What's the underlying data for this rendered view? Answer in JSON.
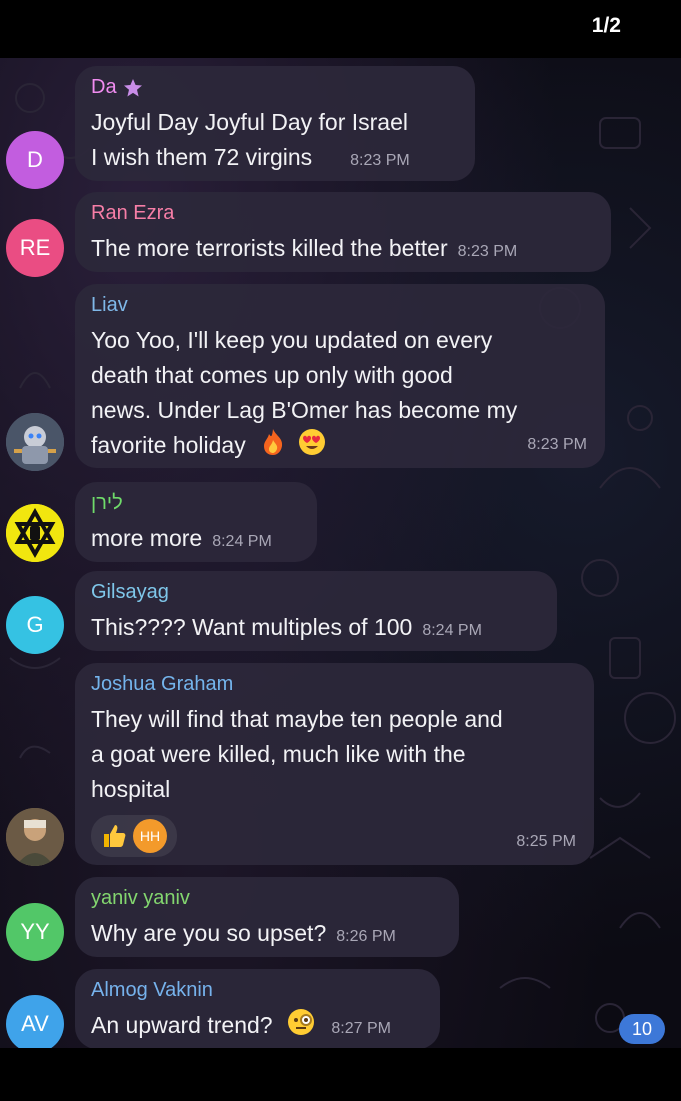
{
  "header": {
    "page_counter": "1/2"
  },
  "messages": [
    {
      "sender": "Da",
      "sender_color": "#f08cf0",
      "avatar_text": "D",
      "avatar_color": "#c25ddf",
      "lines": [
        "Joyful Day Joyful Day for Israel",
        "I wish them 72 virgins"
      ],
      "time": "8:23 PM"
    },
    {
      "sender": "Ran Ezra",
      "sender_color": "#f77ea7",
      "avatar_text": "RE",
      "avatar_color": "#ea4d83",
      "lines": [
        "The more terrorists killed the better"
      ],
      "time": "8:23 PM"
    },
    {
      "sender": "Liav",
      "sender_color": "#7fb8e8",
      "avatar_text": "",
      "avatar_color": "#5a6378",
      "lines": [
        "Yoo Yoo, I'll keep you updated on every",
        "death that comes up only with good",
        "news. Under Lag B'Omer has become my",
        "favorite holiday"
      ],
      "time": "8:23 PM"
    },
    {
      "sender": "לירן",
      "sender_color": "#6fdb6a",
      "avatar_text": "",
      "avatar_color": "#f1e60f",
      "lines": [
        "more more"
      ],
      "time": "8:24 PM"
    },
    {
      "sender": "Gilsayag",
      "sender_color": "#7fc7ea",
      "avatar_text": "G",
      "avatar_color": "#35c2e3",
      "lines": [
        "This???? Want multiples of 100"
      ],
      "time": "8:24 PM"
    },
    {
      "sender": "Joshua Graham",
      "sender_color": "#74b4ec",
      "avatar_text": "",
      "avatar_color": "#7b6a55",
      "lines": [
        "They will find that maybe ten people and",
        "a goat were killed, much like with the",
        "hospital"
      ],
      "time": "8:25 PM",
      "reaction_avatar": "HH"
    },
    {
      "sender": "yaniv yaniv",
      "sender_color": "#83d66f",
      "avatar_text": "YY",
      "avatar_color": "#52c768",
      "lines": [
        "Why are you so upset?"
      ],
      "time": "8:26 PM"
    },
    {
      "sender": "Almog Vaknin",
      "sender_color": "#76b2ec",
      "avatar_text": "AV",
      "avatar_color": "#3fa3ea",
      "lines": [
        "An upward trend?"
      ],
      "time": "8:27 PM"
    }
  ],
  "unread_count": "10",
  "colors": {
    "bubble": "#2c283a",
    "accent_blue": "#3d78d8",
    "star": "#c98de8"
  }
}
